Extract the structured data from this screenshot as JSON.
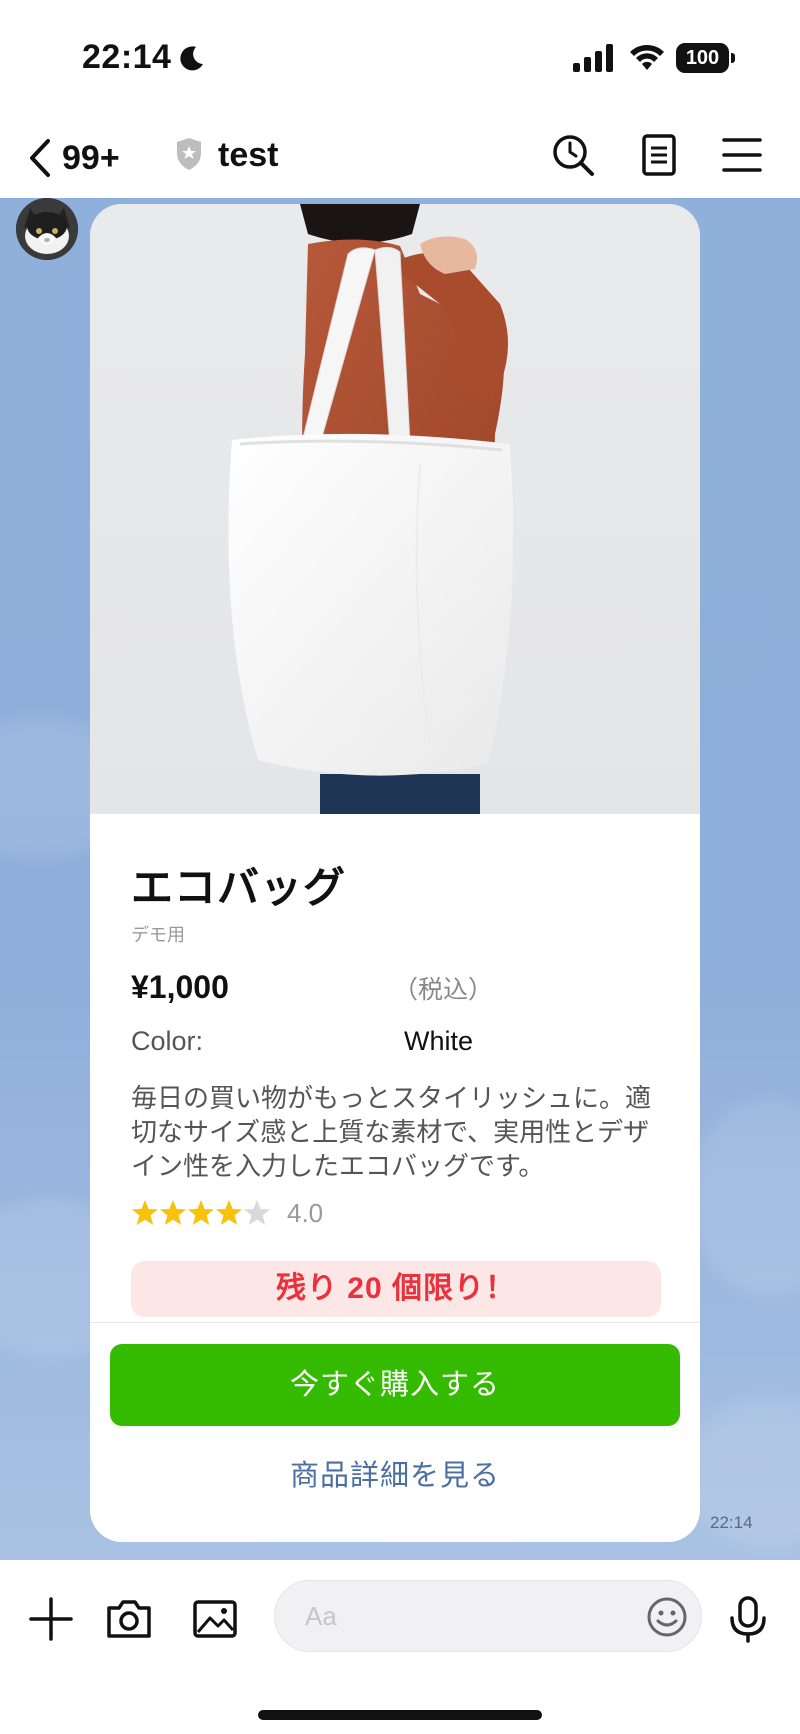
{
  "status_bar": {
    "time": "22:14",
    "battery": "100"
  },
  "header": {
    "back_count": "99+",
    "title": "test"
  },
  "card": {
    "product_name": "エコバッグ",
    "subtitle": "デモ用",
    "price": "¥1,000",
    "tax_note": "（税込）",
    "color_label": "Color:",
    "color_value": "White",
    "description": "毎日の買い物がもっとスタイリッシュに。適切なサイズ感と上質な素材で、実用性とデザイン性を入力したエコバッグです。",
    "rating": {
      "value": "4.0",
      "stars_filled": 4,
      "stars_total": 5
    },
    "stock_notice": "残り 20 個限り！",
    "buy_button": "今すぐ購入する",
    "detail_link": "商品詳細を見る"
  },
  "message_time": "22:14",
  "input": {
    "placeholder": "Aa"
  },
  "colors": {
    "accent_green": "#34bb00",
    "link_blue": "#4a6fa2",
    "alert_red": "#e8323c",
    "chat_bg": "#8fb0da"
  },
  "icons": [
    "moon-icon",
    "signal-icon",
    "wifi-icon",
    "battery-icon",
    "chevron-left-icon",
    "shield-icon",
    "search-icon",
    "notes-icon",
    "menu-icon",
    "star-icon",
    "plus-icon",
    "camera-icon",
    "image-icon",
    "emoji-icon",
    "mic-icon"
  ]
}
